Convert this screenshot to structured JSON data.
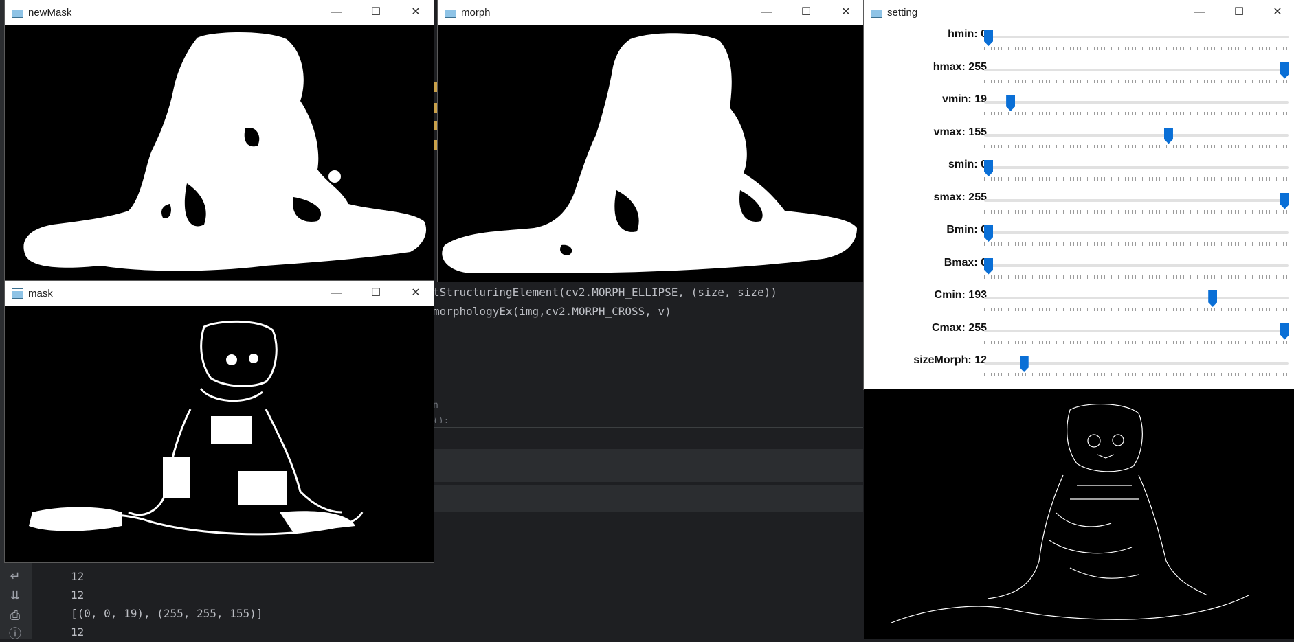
{
  "ide": {
    "code_lines": [
      "tStructuringElement(cv2.MORPH_ELLIPSE, (size, size))",
      "morphologyEx(img,cv2.MORPH_CROSS, v)",
      "n",
      "():"
    ],
    "console_lines": [
      "12",
      "12",
      "[(0, 0, 19), (255, 255, 155)]",
      "12"
    ],
    "tool_icons": [
      "wrap-icon",
      "scroll-end-icon",
      "print-icon",
      "info-icon"
    ]
  },
  "windows": {
    "newMask": {
      "title": "newMask"
    },
    "morph": {
      "title": "morph"
    },
    "mask": {
      "title": "mask"
    },
    "setting": {
      "title": "setting"
    }
  },
  "window_controls": {
    "minimize": "—",
    "maximize": "☐",
    "close": "✕"
  },
  "setting": {
    "trackbars": [
      {
        "label": "hmin: 0",
        "value": 0,
        "max": 255
      },
      {
        "label": "hmax: 255",
        "value": 255,
        "max": 255
      },
      {
        "label": "vmin: 19",
        "value": 19,
        "max": 255
      },
      {
        "label": "vmax: 155",
        "value": 155,
        "max": 255
      },
      {
        "label": "smin: 0",
        "value": 0,
        "max": 255
      },
      {
        "label": "smax: 255",
        "value": 255,
        "max": 255
      },
      {
        "label": "Bmin: 0",
        "value": 0,
        "max": 255
      },
      {
        "label": "Bmax: 0",
        "value": 0,
        "max": 255
      },
      {
        "label": "Cmin: 193",
        "value": 193,
        "max": 255
      },
      {
        "label": "Cmax: 255",
        "value": 255,
        "max": 255
      },
      {
        "label": "sizeMorph: 12",
        "value": 12,
        "max": 100
      }
    ]
  },
  "colors": {
    "accent": "#0a6fd6",
    "ide_bg": "#1e1f22"
  }
}
